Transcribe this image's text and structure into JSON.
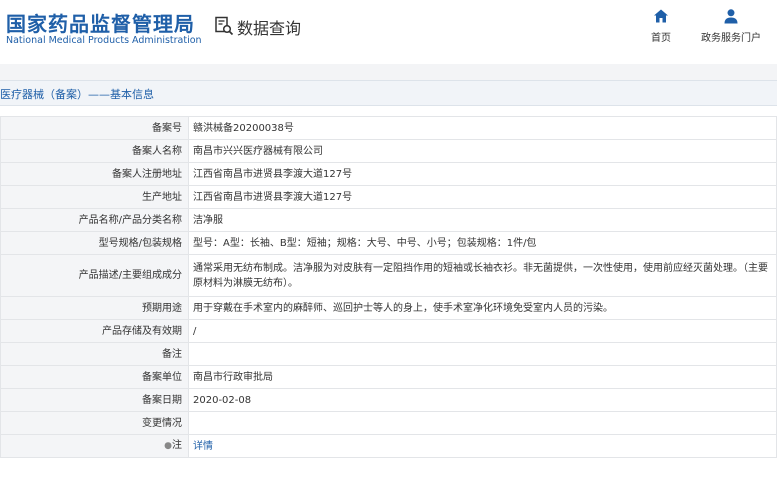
{
  "header": {
    "logo_cn": "国家药品监督管理局",
    "logo_en": "National Medical Products Administration",
    "query_title": "数据查询",
    "nav": [
      {
        "label": "首页",
        "icon": "home-icon"
      },
      {
        "label": "政务服务门户",
        "icon": "user-icon"
      }
    ]
  },
  "section_title": "医疗器械（备案）——基本信息",
  "rows": [
    {
      "label": "备案号",
      "value": "赣洪械备20200038号"
    },
    {
      "label": "备案人名称",
      "value": "南昌市兴兴医疗器械有限公司"
    },
    {
      "label": "备案人注册地址",
      "value": "江西省南昌市进贤县李渡大道127号"
    },
    {
      "label": "生产地址",
      "value": "江西省南昌市进贤县李渡大道127号"
    },
    {
      "label": "产品名称/产品分类名称",
      "value": "洁净服"
    },
    {
      "label": "型号规格/包装规格",
      "value": "型号：A型：长袖、B型：短袖；规格：大号、中号、小号；包装规格：1件/包"
    },
    {
      "label": "产品描述/主要组成成分",
      "value": "通常采用无纺布制成。洁净服为对皮肤有一定阻挡作用的短袖或长袖衣衫。非无菌提供，一次性使用，使用前应经灭菌处理。（主要原材料为淋膜无纺布）。"
    },
    {
      "label": "预期用途",
      "value": "用于穿戴在手术室内的麻醉师、巡回护士等人的身上，使手术室净化环境免受室内人员的污染。"
    },
    {
      "label": "产品存储及有效期",
      "value": "/"
    },
    {
      "label": "备注",
      "value": ""
    },
    {
      "label": "备案单位",
      "value": "南昌市行政审批局"
    },
    {
      "label": "备案日期",
      "value": "2020-02-08"
    },
    {
      "label": "变更情况",
      "value": ""
    },
    {
      "label": "注",
      "value": "详情"
    }
  ],
  "colors": {
    "brand": "#1f5fa8",
    "label_bg": "#f4f5f7",
    "border": "#e3e5e8"
  }
}
